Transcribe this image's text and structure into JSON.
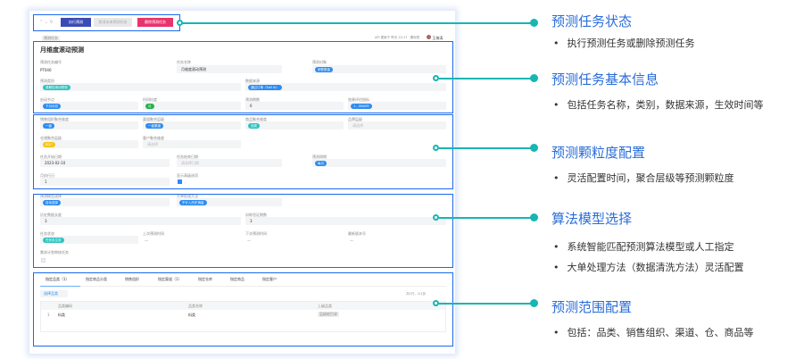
{
  "toolbar": {
    "run": "执行预测",
    "cancel": "取消未来预测任务",
    "delete": "删除预测任务"
  },
  "header": {
    "breadcrumb": "预测任务",
    "meta": "API 更新于 昨天 22:17 · 跟标签",
    "user": "王海涛"
  },
  "page_title": "月维度滚动预测",
  "basic": {
    "code_label": "预测任务编号",
    "code_value": "PT046",
    "name_label": "任务名称",
    "name_value": "月维度滚动预测",
    "target_label": "预测对象",
    "target_value": "销售数量",
    "category_label": "预测类别",
    "category_value": "周期性滚动预测",
    "source_label": "数据来源",
    "source_value": "通过订单（Sell In）",
    "start_label": "启动节点",
    "start_value": "下月月初",
    "grain_label": "时间粒度",
    "grain_value": "月",
    "periods_label": "预测期数",
    "periods_value": "6",
    "metric_label": "效果评估指标",
    "metric_value": "1 - SMAPE"
  },
  "granularity": {
    "org_label": "销售组织聚合维度",
    "org_value": "一级",
    "channel_label": "渠道聚合层级",
    "channel_value": "一级渠道",
    "product_label": "商品聚合维度",
    "product_value": "品类",
    "brand_label": "品牌层级",
    "brand_value": "请选择",
    "wh_label": "仓储聚合层级",
    "wh_value": "RDC",
    "cust_label": "客户聚合维度",
    "cust_value": "请选择",
    "sdate_label": "任务开始日期",
    "sdate_value": "2023-02-10",
    "edate_label": "任务结束日期",
    "edate_value": "请选择日期",
    "cycle_label": "预测周期",
    "cycle_value": "每月",
    "exec_label": "月执行日",
    "exec_value": "1",
    "adv_label": "显示高级选项"
  },
  "algorithm": {
    "model_label": "预测模型选择",
    "model_value": "自动选择",
    "big_label": "大单处理方法",
    "big_value": "不计入历史销量",
    "hist_label": "历史数据长度",
    "hist_value": "3",
    "train_label": "训练验证期数",
    "train_value": "3",
    "status_label": "任务状态",
    "status_value": "任务未生效",
    "last_label": "上次预测时间",
    "last_value": "—",
    "next_label": "下次预测时间",
    "next_value": "—",
    "ver_label": "最新版本号",
    "ver_value": "—",
    "plan_label": "需求计划审核任务"
  },
  "scope": {
    "tabs": [
      "指定品类（1）",
      "指定商品分类",
      "销售组织",
      "指定渠道（1）",
      "指定仓库",
      "指定商品",
      "指定客户"
    ],
    "select_btn": "选择品类",
    "pagination": "共1行，1/1页",
    "columns": [
      "品类编码",
      "品类名称",
      "上级品类"
    ],
    "rows": [
      [
        "1",
        "料类",
        "料类",
        "层级根目录"
      ]
    ]
  },
  "annotations": [
    {
      "title": "预测任务状态",
      "bullets": [
        "执行预测任务或删除预测任务"
      ]
    },
    {
      "title": "预测任务基本信息",
      "bullets": [
        "包括任务名称，类别，数据来源，生效时间等"
      ]
    },
    {
      "title": "预测颗粒度配置",
      "bullets": [
        "灵活配置时间，聚合层级等预测颗粒度"
      ]
    },
    {
      "title": "算法模型选择",
      "bullets": [
        "系统智能匹配预测算法模型或人工指定",
        "大单处理方法（数据清洗方法）灵活配置"
      ]
    },
    {
      "title": "预测范围配置",
      "bullets": [
        "包括：品类、销售组织、渠道、仓、商品等"
      ]
    }
  ],
  "colors": {
    "accent": "#16b6b2",
    "box": "#1a6af0",
    "title": "#2a6dd9",
    "pill": "#2d8cf0",
    "run": "#3b4bb5",
    "delete": "#e8336d"
  }
}
